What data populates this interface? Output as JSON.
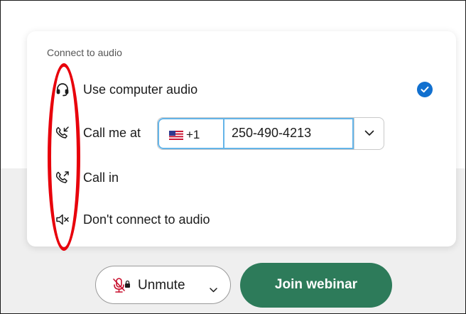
{
  "dialog": {
    "section_label": "Connect to audio",
    "options": [
      {
        "icon": "headset-icon",
        "label": "Use computer audio",
        "selected": true
      },
      {
        "icon": "phone-callback-icon",
        "label": "Call me at"
      },
      {
        "icon": "phone-outgoing-icon",
        "label": "Call in"
      },
      {
        "icon": "speaker-muted-icon",
        "label": "Don't connect to audio"
      }
    ],
    "phone": {
      "country_icon": "us-flag-icon",
      "country_code": "+1",
      "number": "250-490-4213"
    }
  },
  "footer": {
    "unmute_label": "Unmute",
    "join_label": "Join webinar"
  },
  "colors": {
    "accent_blue": "#1170cf",
    "join_green": "#2d7b5a",
    "annotation_red": "#e8000b",
    "field_focus": "#64b4e8"
  }
}
